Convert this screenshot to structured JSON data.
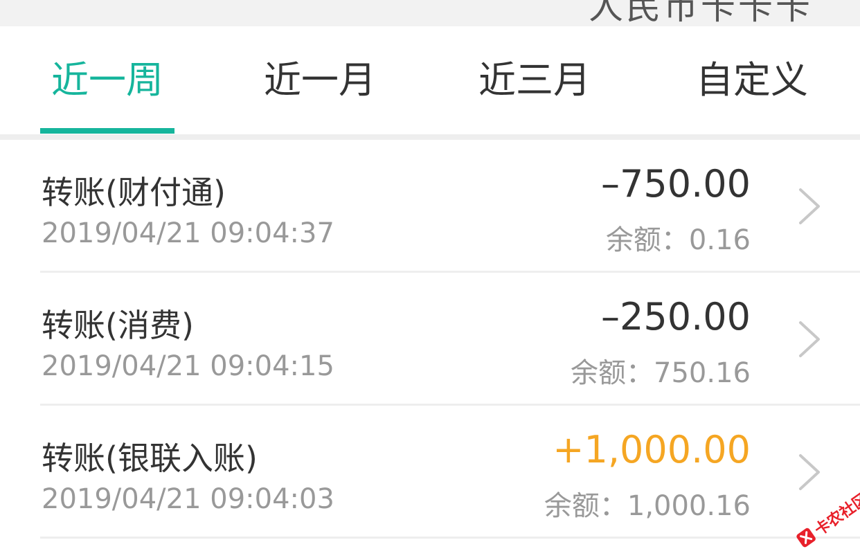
{
  "header": {
    "partial_title": "人民币卡卡卡"
  },
  "tabs": [
    {
      "label": "近一周",
      "active": true
    },
    {
      "label": "近一月",
      "active": false
    },
    {
      "label": "近三月",
      "active": false
    },
    {
      "label": "自定义",
      "active": false
    }
  ],
  "transactions": [
    {
      "title": "转账(财付通)",
      "time": "2019/04/21 09:04:37",
      "amount": "–750.00",
      "balance": "余额：0.16",
      "type": "expense"
    },
    {
      "title": "转账(消费)",
      "time": "2019/04/21 09:04:15",
      "amount": "–250.00",
      "balance": "余额：750.16",
      "type": "expense"
    },
    {
      "title": "转账(银联入账)",
      "time": "2019/04/21 09:04:03",
      "amount": "+1,000.00",
      "balance": "余额：1,000.16",
      "type": "income"
    }
  ],
  "watermark": {
    "text": "卡农社区"
  },
  "colors": {
    "accent": "#16b59c",
    "income": "#f5a623",
    "text_primary": "#333333",
    "text_secondary": "#999999",
    "watermark": "#e8202a"
  },
  "icons": {
    "row_arrow": "chevron-right-icon",
    "watermark_logo": "kanong-logo-icon"
  }
}
